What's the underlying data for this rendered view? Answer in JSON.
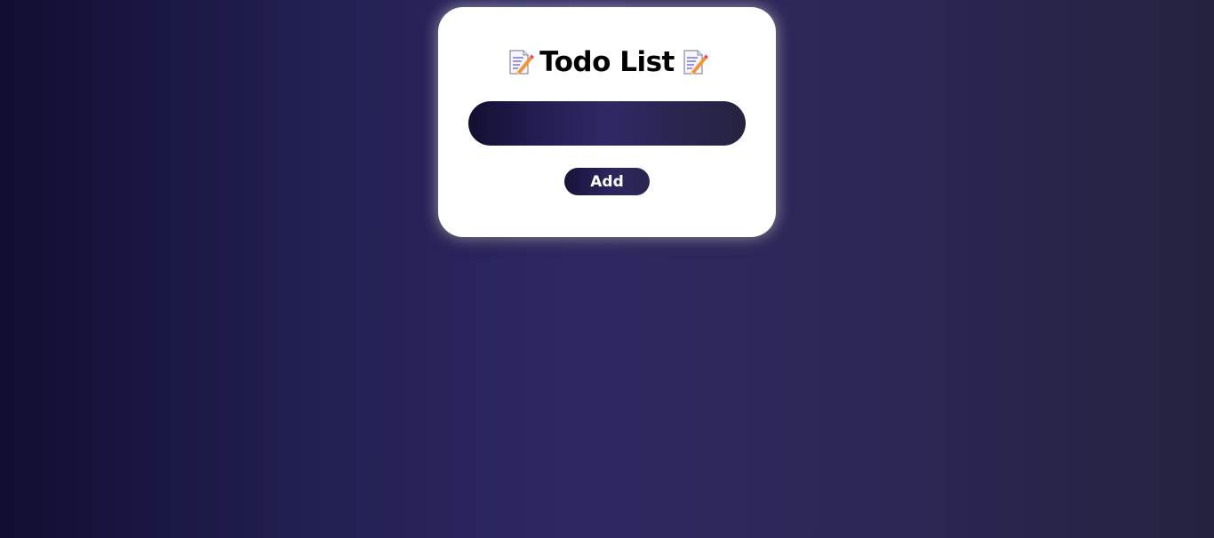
{
  "app": {
    "title": "Todo List"
  },
  "icons": {
    "left": "memo-pencil-icon",
    "right": "memo-pencil-icon"
  },
  "form": {
    "input_value": "",
    "input_placeholder": "",
    "add_label": "Add"
  },
  "colors": {
    "background_start": "#110e32",
    "background_mid": "#2e2862",
    "background_end": "#25223f",
    "card": "#ffffff",
    "text": "#000000",
    "button_text": "#ffffff"
  }
}
